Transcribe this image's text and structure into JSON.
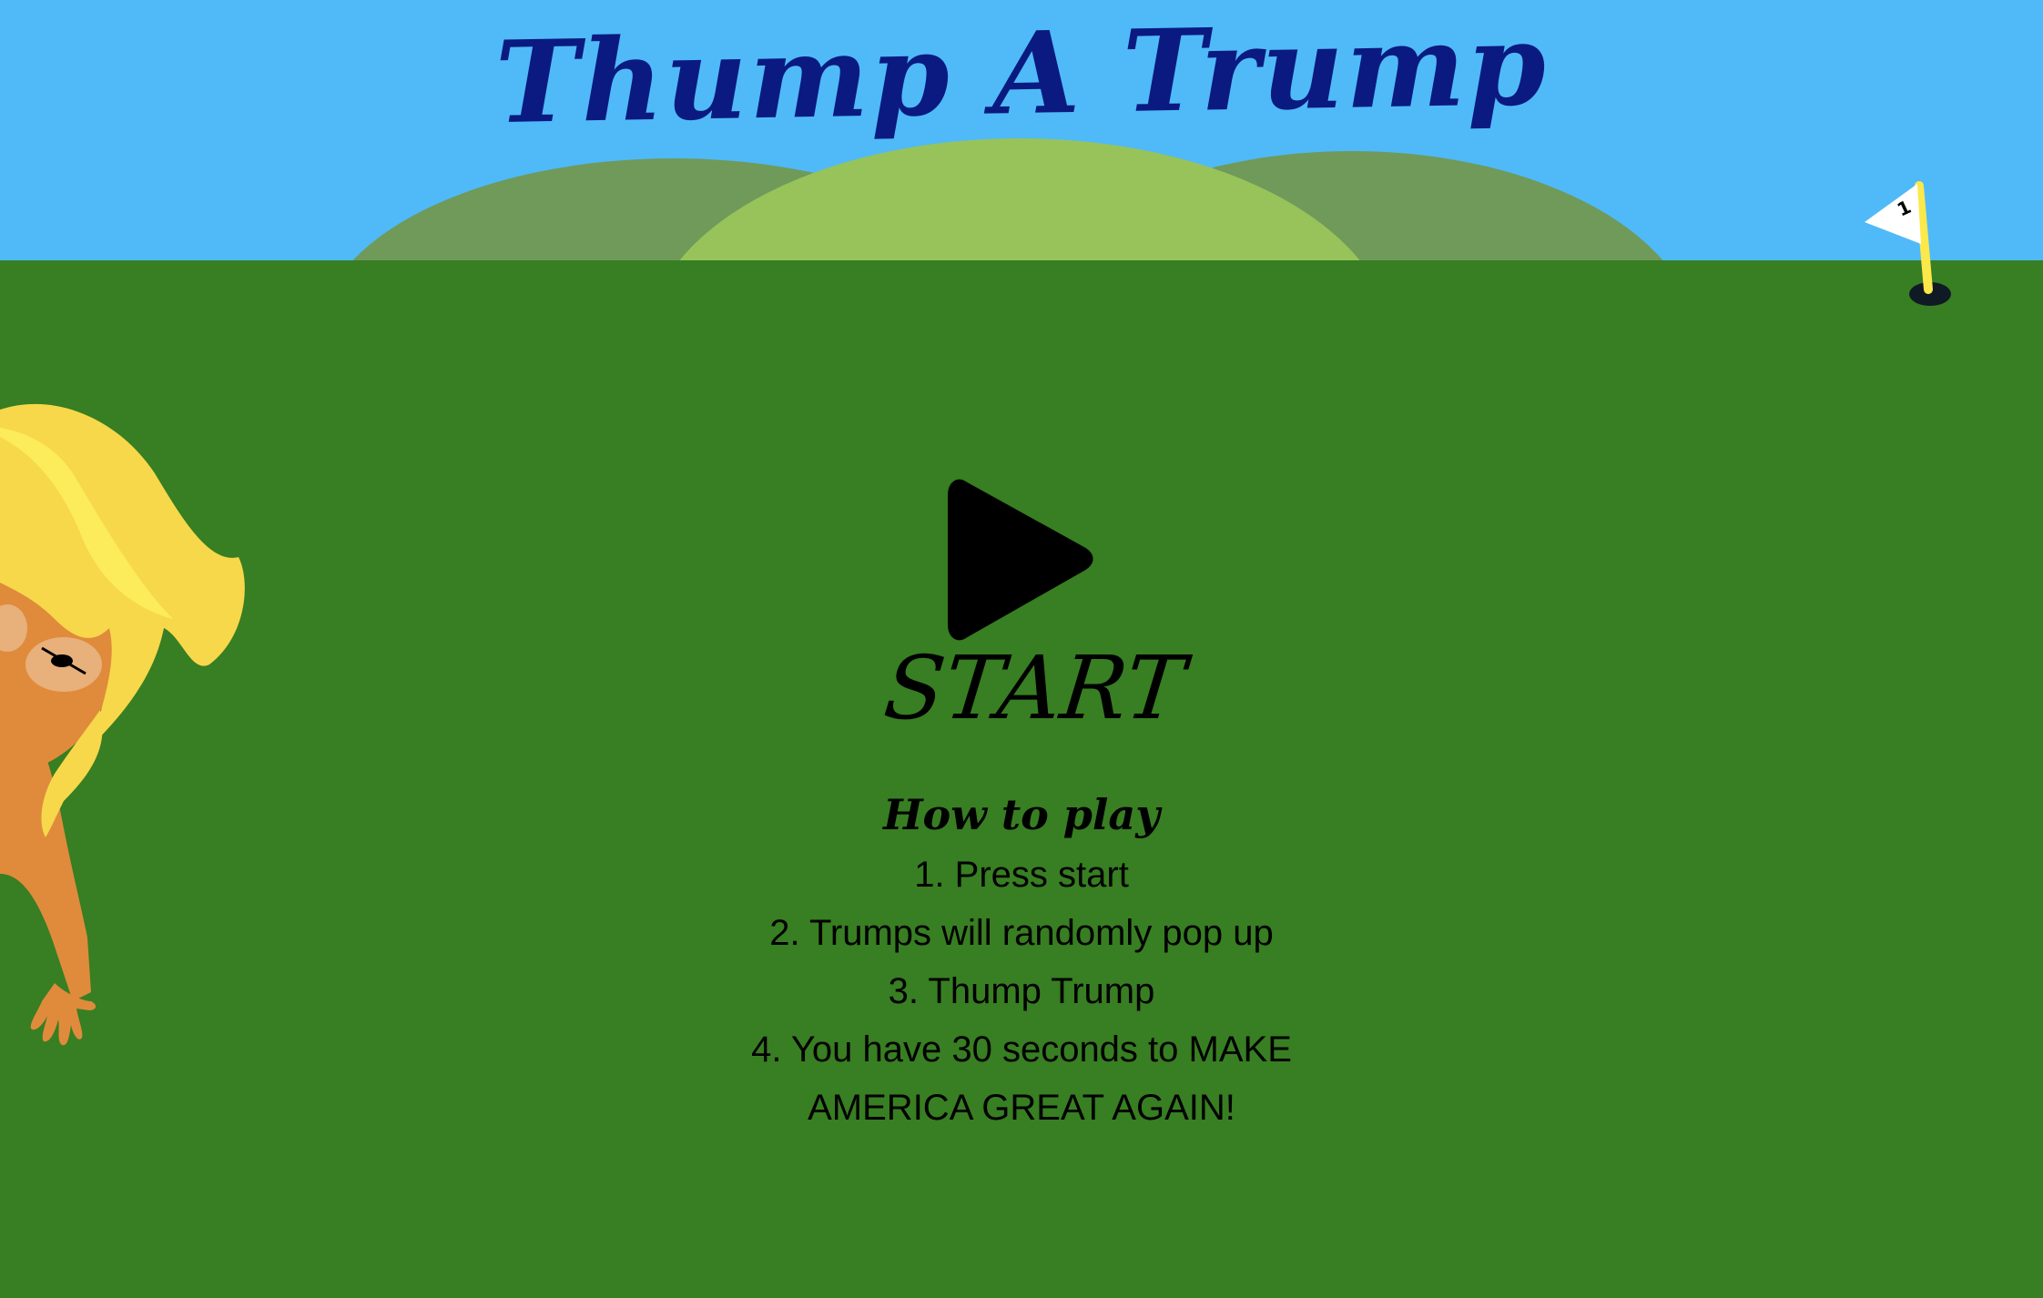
{
  "game": {
    "title": "Thump A Trump",
    "start_label": "START",
    "howto_heading": "How to play",
    "steps": [
      "1. Press start",
      "2. Trumps will randomly pop up",
      "3. Thump Trump",
      "4. You have 30 seconds to MAKE AMERICA GREAT AGAIN!"
    ],
    "flag_number": "1"
  },
  "icons": {
    "play": "play-icon",
    "flag": "golf-flag-icon",
    "character": "trump-character-illustration"
  },
  "colors": {
    "sky": "#4fbaf7",
    "ground": "#387e22",
    "hill_dark": "#6f9a5a",
    "hill_light": "#97c35a",
    "title": "#0a1a80",
    "flag_pole": "#fbe84b",
    "flag_cloth": "#ffffff",
    "hair": "#f7d84a",
    "skin": "#e08b3c"
  }
}
